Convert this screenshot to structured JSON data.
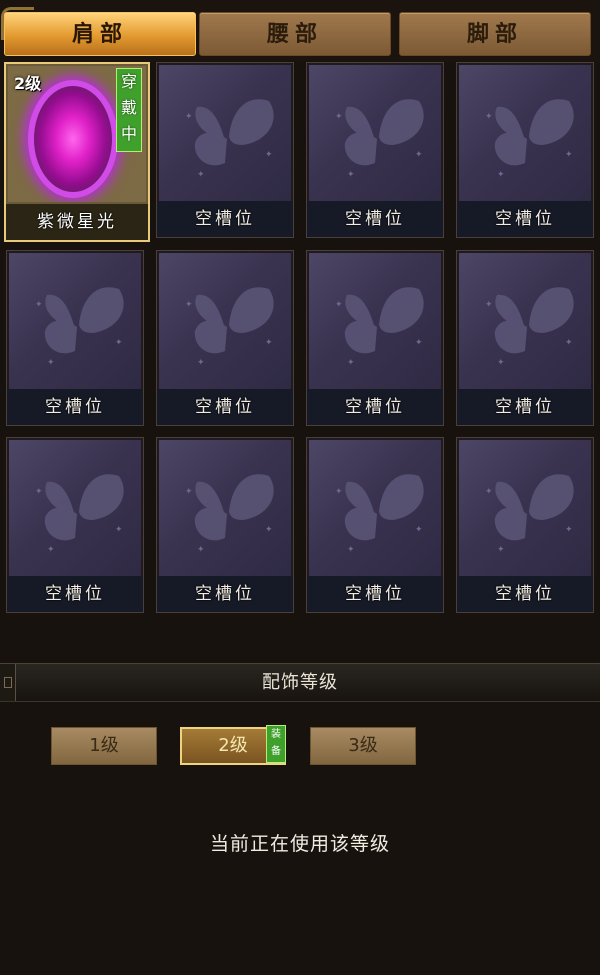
{
  "tabs": [
    {
      "label": "肩部",
      "active": true
    },
    {
      "label": "腰部",
      "active": false
    },
    {
      "label": "脚部",
      "active": false
    }
  ],
  "slots": [
    {
      "name": "紫微星光",
      "equipped": true,
      "level": "2级",
      "status_tag": [
        "穿",
        "戴",
        "中"
      ]
    },
    {
      "name": "空槽位"
    },
    {
      "name": "空槽位"
    },
    {
      "name": "空槽位"
    },
    {
      "name": "空槽位"
    },
    {
      "name": "空槽位"
    },
    {
      "name": "空槽位"
    },
    {
      "name": "空槽位"
    },
    {
      "name": "空槽位"
    },
    {
      "name": "空槽位"
    },
    {
      "name": "空槽位"
    },
    {
      "name": "空槽位"
    }
  ],
  "level_section": {
    "title": "配饰等级",
    "levels": [
      {
        "label": "1级",
        "current": false
      },
      {
        "label": "2级",
        "current": true
      },
      {
        "label": "3级",
        "current": false
      }
    ],
    "equip_tag": [
      "装",
      "备"
    ],
    "status_text": "当前正在使用该等级"
  },
  "colors": {
    "accent_gold": "#e9c97a",
    "equipped_green": "#3fa12c",
    "orb_magenta": "#e021c8"
  },
  "icons": {
    "empty_slot": "butterfly-icon",
    "equipped_item": "purple-orb-icon"
  }
}
